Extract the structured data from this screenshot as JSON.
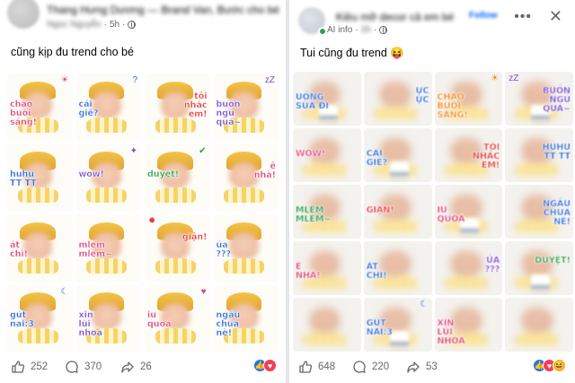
{
  "left_post": {
    "author": "Thang Hưng Dương — Brand Van, Bước cho bé",
    "meta_name": "Ngọc Nguyễn",
    "time": "5h",
    "caption": "cũng kịp đu trend cho bé",
    "stickers": [
      {
        "text": "chào\nbuổi\nsáng!",
        "color": "#e0457b",
        "pos": "left",
        "deco": "☀",
        "hat": true
      },
      {
        "text": "cái\ngiề?",
        "color": "#2f6fe0",
        "pos": "left",
        "deco": "?",
        "hat": true
      },
      {
        "text": "tôi\nnhắc\nem!",
        "color": "#e23c3c",
        "pos": "right",
        "deco": "",
        "hat": true
      },
      {
        "text": "buồn\nngủ\nquá~",
        "color": "#7a4fd6",
        "pos": "left",
        "deco": "zZ",
        "hat": true
      },
      {
        "text": "huhu\nTT TT",
        "color": "#2f6fe0",
        "pos": "left",
        "deco": "",
        "hat": true
      },
      {
        "text": "wow!",
        "color": "#7a4fd6",
        "pos": "left",
        "deco": "✦",
        "hat": true
      },
      {
        "text": "duyệt!",
        "color": "#2e9e4a",
        "pos": "left",
        "deco": "✔",
        "hat": true
      },
      {
        "text": "ê\nnhà!",
        "color": "#e0457b",
        "pos": "right",
        "deco": "",
        "hat": true
      },
      {
        "text": "át\nchì!",
        "color": "#e0457b",
        "pos": "left",
        "deco": "",
        "hat": true
      },
      {
        "text": "mlem\nmlem~",
        "color": "#e0457b",
        "pos": "left",
        "deco": "",
        "hat": true
      },
      {
        "text": "giận!",
        "color": "#e23c3c",
        "pos": "right",
        "deco": "✹",
        "hat": true
      },
      {
        "text": "ủa\n???",
        "color": "#2f6fe0",
        "pos": "left",
        "deco": "",
        "hat": true
      },
      {
        "text": "gút\nnai:3",
        "color": "#2f6fe0",
        "pos": "left",
        "deco": "☾",
        "hat": true
      },
      {
        "text": "xin\nlũi\nnhoa",
        "color": "#7a4fd6",
        "pos": "left",
        "deco": "",
        "hat": true
      },
      {
        "text": "iu\nquoá",
        "color": "#e0457b",
        "pos": "left",
        "deco": "♥",
        "hat": true
      },
      {
        "text": "ngầu\nchưa\nnè!",
        "color": "#2f6fe0",
        "pos": "left",
        "deco": "",
        "hat": true
      }
    ],
    "likes": "252",
    "comments": "370",
    "shares": "26"
  },
  "right_post": {
    "author": "Kiều mỡ decor cả em bé",
    "follow_label": "Follow",
    "meta_name": "AI info",
    "time": "2h",
    "caption": "Tui cũng đu trend 😝",
    "stickers": [
      {
        "text": "UỐNG\nSỮA ĐI",
        "color": "#2f6fe0",
        "pos": "left",
        "deco": "",
        "hat": false
      },
      {
        "text": "ỰC\nỰC",
        "color": "#2f6fe0",
        "pos": "right",
        "deco": "",
        "hat": false
      },
      {
        "text": "CHÀO\nBUỔI\nSÁNG!",
        "color": "#f08a1c",
        "pos": "left",
        "deco": "☀",
        "hat": false
      },
      {
        "text": "BUỒN\nNGỦ\nQUÁ~",
        "color": "#7a4fd6",
        "pos": "right",
        "deco": "zZ",
        "hat": false
      },
      {
        "text": "WOW!",
        "color": "#e0457b",
        "pos": "left",
        "deco": "",
        "hat": false
      },
      {
        "text": "CÁI\nGIỀ?",
        "color": "#2f6fe0",
        "pos": "left",
        "deco": "",
        "hat": false
      },
      {
        "text": "TÔI\nNHẮC\nEM!",
        "color": "#e23c3c",
        "pos": "right",
        "deco": "",
        "hat": false
      },
      {
        "text": "HUHU\nTT TT",
        "color": "#2f6fe0",
        "pos": "right",
        "deco": "",
        "hat": false
      },
      {
        "text": "MLEM\nMLEM~",
        "color": "#2e9e4a",
        "pos": "left",
        "deco": "",
        "hat": false
      },
      {
        "text": "GIẬN!",
        "color": "#e23c3c",
        "pos": "left",
        "deco": "",
        "hat": false
      },
      {
        "text": "IU\nQUOÁ",
        "color": "#e0457b",
        "pos": "left",
        "deco": "",
        "hat": false
      },
      {
        "text": "NGẦU\nCHƯA\nNÈ!",
        "color": "#2f6fe0",
        "pos": "right",
        "deco": "",
        "hat": false
      },
      {
        "text": "Ê\nNHÀ!",
        "color": "#e0457b",
        "pos": "left",
        "deco": "",
        "hat": false
      },
      {
        "text": "ÁT\nCHÌ!",
        "color": "#2f6fe0",
        "pos": "left",
        "deco": "",
        "hat": false
      },
      {
        "text": "ỦA\n???",
        "color": "#7a4fd6",
        "pos": "right",
        "deco": "",
        "hat": false
      },
      {
        "text": "DUYỆT!",
        "color": "#2e9e4a",
        "pos": "right",
        "deco": "",
        "hat": false
      },
      {
        "text": "",
        "color": "#2f6fe0",
        "pos": "left",
        "deco": "",
        "hat": false
      },
      {
        "text": "GÚT\nNAI:3",
        "color": "#2f6fe0",
        "pos": "left",
        "deco": "☾",
        "hat": false
      },
      {
        "text": "XIN\nLŨI\nNHOA",
        "color": "#e0457b",
        "pos": "left",
        "deco": "",
        "hat": false
      },
      {
        "text": "",
        "color": "#e0457b",
        "pos": "left",
        "deco": "",
        "hat": false
      }
    ],
    "likes": "648",
    "comments": "220",
    "shares": "53"
  },
  "icons": {
    "more": "ellipsis-icon",
    "close": "close-icon",
    "like": "thumbs-up-icon",
    "comment": "comment-icon",
    "share": "share-icon"
  }
}
